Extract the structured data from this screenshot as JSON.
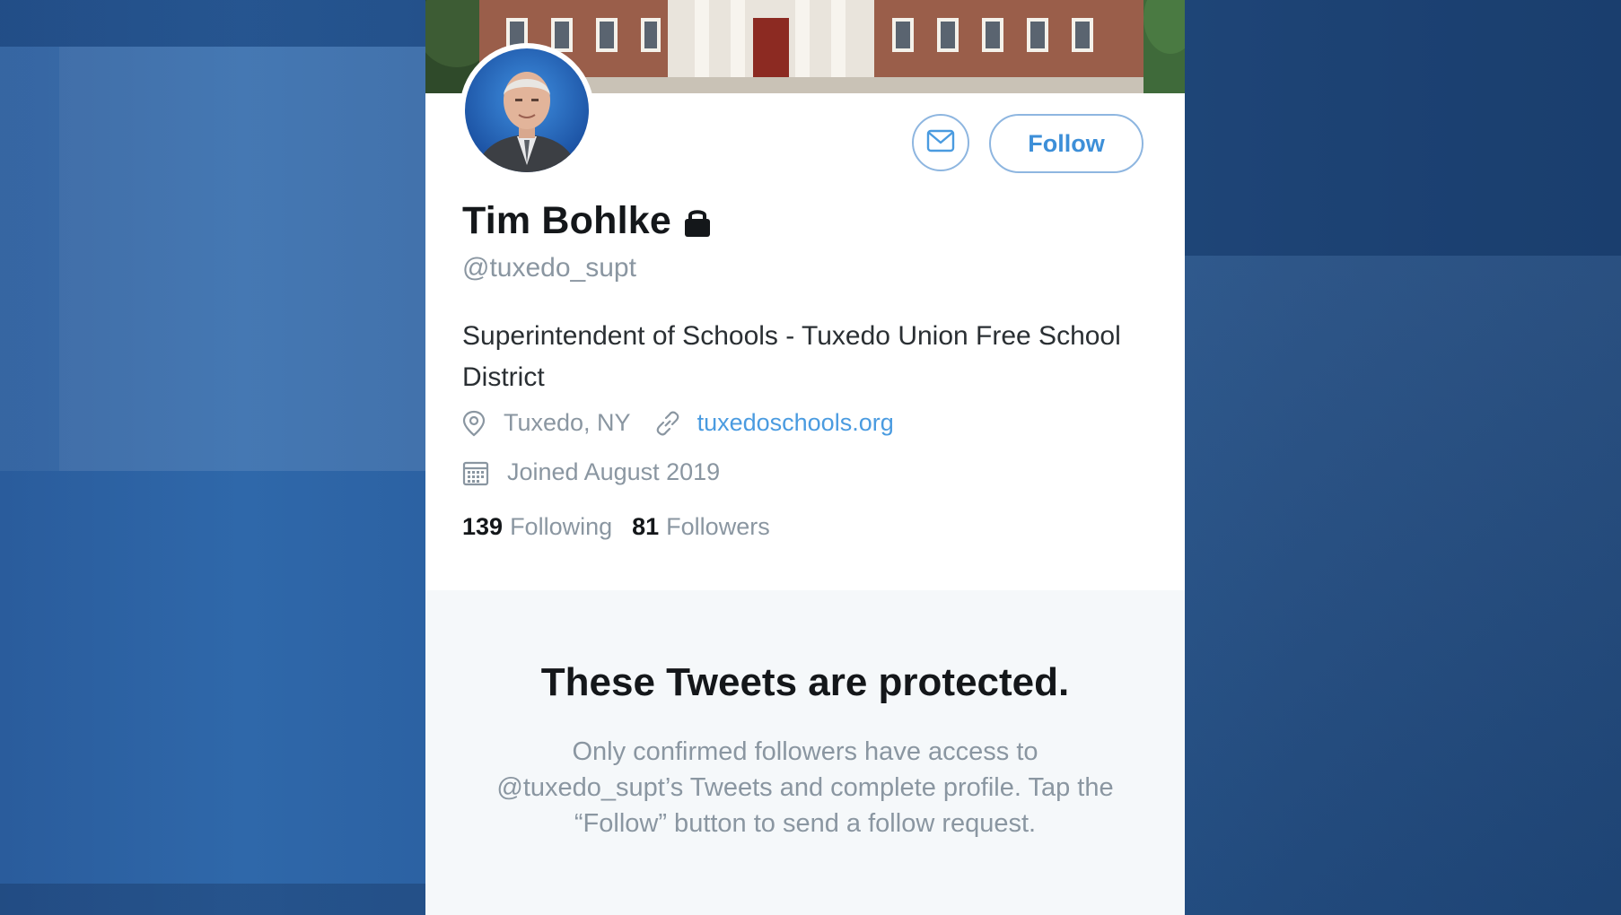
{
  "profile": {
    "name": "Tim Bohlke",
    "handle": "@tuxedo_supt",
    "bio": "Superintendent of Schools - Tuxedo Union Free School District",
    "location": "Tuxedo, NY",
    "website": "tuxedoschools.org",
    "joined": "Joined August 2019",
    "following_count": "139",
    "following_label": "Following",
    "followers_count": "81",
    "followers_label": "Followers"
  },
  "actions": {
    "follow_label": "Follow",
    "message_icon": "mail-icon"
  },
  "protected": {
    "title": "These Tweets are protected.",
    "message": "Only confirmed followers have access to @tuxedo_supt’s Tweets and complete profile. Tap the “Follow” button to send a follow request."
  },
  "icons": {
    "lock": "lock-icon",
    "location": "location-pin-icon",
    "link": "link-icon",
    "calendar": "calendar-icon"
  },
  "colors": {
    "accent": "#3d8fd8",
    "button_border": "#8eb6e0",
    "secondary_text": "#8a96a1",
    "background_blue": "#2a5c9c"
  }
}
